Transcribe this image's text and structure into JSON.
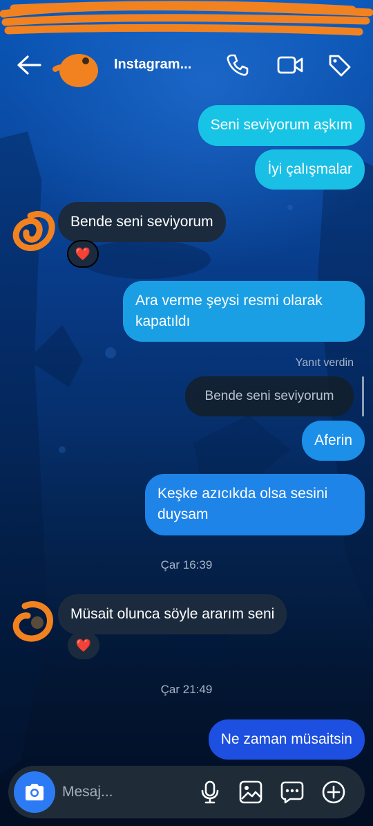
{
  "header": {
    "title": "Instagram...",
    "back_icon": "arrow-left-icon",
    "call_icon": "phone-icon",
    "video_icon": "video-camera-icon",
    "tag_icon": "tag-icon"
  },
  "messages": [
    {
      "direction": "outgoing",
      "text": "Seni seviyorum aşkım"
    },
    {
      "direction": "outgoing",
      "text": "İyi çalışmalar"
    },
    {
      "direction": "incoming",
      "text": "Bende seni seviyorum",
      "reaction": "❤️"
    },
    {
      "direction": "outgoing",
      "text": "Ara verme şeysi resmi olarak kapatıldı"
    },
    {
      "direction": "outgoing",
      "reply_label": "Yanıt verdin",
      "quoted": "Bende seni seviyorum",
      "text": "Aferin"
    },
    {
      "direction": "outgoing",
      "text": "Keşke azıcıkda olsa sesini duysam"
    },
    {
      "type": "timestamp",
      "text": "Çar 16:39"
    },
    {
      "direction": "incoming",
      "text": "Müsait olunca söyle ararım seni",
      "reaction": "❤️"
    },
    {
      "type": "timestamp",
      "text": "Çar 21:49"
    },
    {
      "direction": "outgoing",
      "text": "Ne zaman müsaitsin"
    }
  ],
  "composer": {
    "placeholder": "Mesaj...",
    "icons": [
      "camera-icon",
      "microphone-icon",
      "image-icon",
      "sticker-chat-icon",
      "plus-circle-icon"
    ]
  },
  "colors": {
    "outgoing_light": "#18c4e6",
    "outgoing_mid": "#1f86e8",
    "outgoing_deep": "#1d4fe0",
    "incoming": "#1b2b3d",
    "accent": "#2d7bf4",
    "scribble": "#f2821f",
    "heart": "#ff2f4f"
  }
}
